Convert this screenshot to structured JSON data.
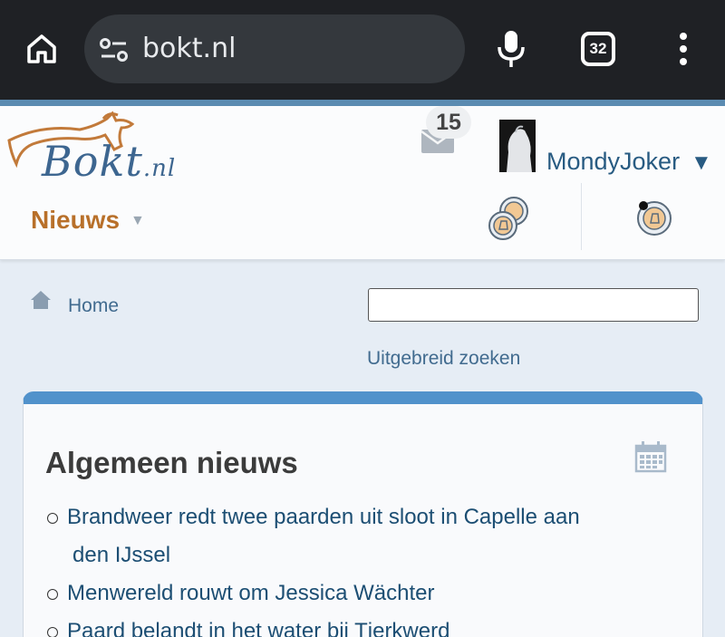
{
  "browser": {
    "url": "bokt.nl",
    "tab_count": "32"
  },
  "header": {
    "logo_text": "Bokt",
    "logo_suffix": ".nl",
    "mail_count": "15",
    "username": "MondyJoker",
    "user_menu_caret": "▼",
    "nav_title": "Nieuws",
    "nav_caret": "▼"
  },
  "breadcrumb": {
    "home_label": "Home"
  },
  "search": {
    "value": "",
    "advanced_label": "Uitgebreid zoeken"
  },
  "card": {
    "title": "Algemeen nieuws",
    "items": [
      {
        "line1": "Brandweer redt twee paarden uit sloot in Capelle aan",
        "line2": "den IJssel"
      },
      {
        "line1": "Menwereld rouwt om Jessica Wächter",
        "line2": ""
      },
      {
        "line1": "Paard belandt in het water bij Tjerkwerd",
        "line2": ""
      }
    ]
  },
  "colors": {
    "chrome_bg": "#1f2125",
    "accent_blue": "#5192cb",
    "link_blue": "#1c4e73",
    "nav_orange": "#b8702a"
  }
}
